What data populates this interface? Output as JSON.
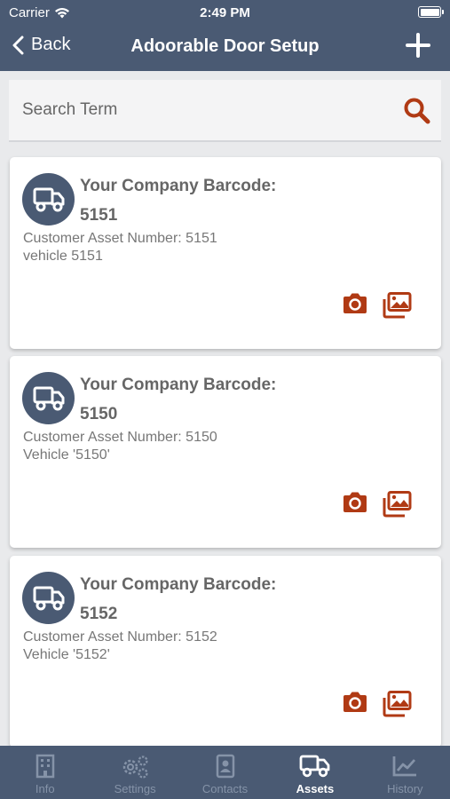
{
  "status_bar": {
    "carrier": "Carrier",
    "time": "2:49 PM"
  },
  "nav": {
    "back_label": "Back",
    "title": "Adoorable Door Setup",
    "add_icon": "plus-icon"
  },
  "search": {
    "placeholder": "Search Term",
    "value": "",
    "icon": "search-icon"
  },
  "colors": {
    "header_bg": "#4a5a73",
    "accent": "#b03a14",
    "page_bg": "#e9eaec",
    "card_bg": "#ffffff"
  },
  "assets": [
    {
      "barcode_label": "Your Company Barcode:",
      "barcode": "5151",
      "asset_number": "Customer Asset Number: 5151",
      "description": "vehicle 5151"
    },
    {
      "barcode_label": "Your Company Barcode:",
      "barcode": "5150",
      "asset_number": "Customer Asset Number: 5150",
      "description": "Vehicle '5150'"
    },
    {
      "barcode_label": "Your Company Barcode:",
      "barcode": "5152",
      "asset_number": "Customer Asset Number: 5152",
      "description": "Vehicle '5152'"
    }
  ],
  "tabs": [
    {
      "label": "Info",
      "icon": "building-icon",
      "active": false
    },
    {
      "label": "Settings",
      "icon": "gears-icon",
      "active": false
    },
    {
      "label": "Contacts",
      "icon": "contact-book-icon",
      "active": false
    },
    {
      "label": "Assets",
      "icon": "truck-icon",
      "active": true
    },
    {
      "label": "History",
      "icon": "chart-icon",
      "active": false
    }
  ]
}
